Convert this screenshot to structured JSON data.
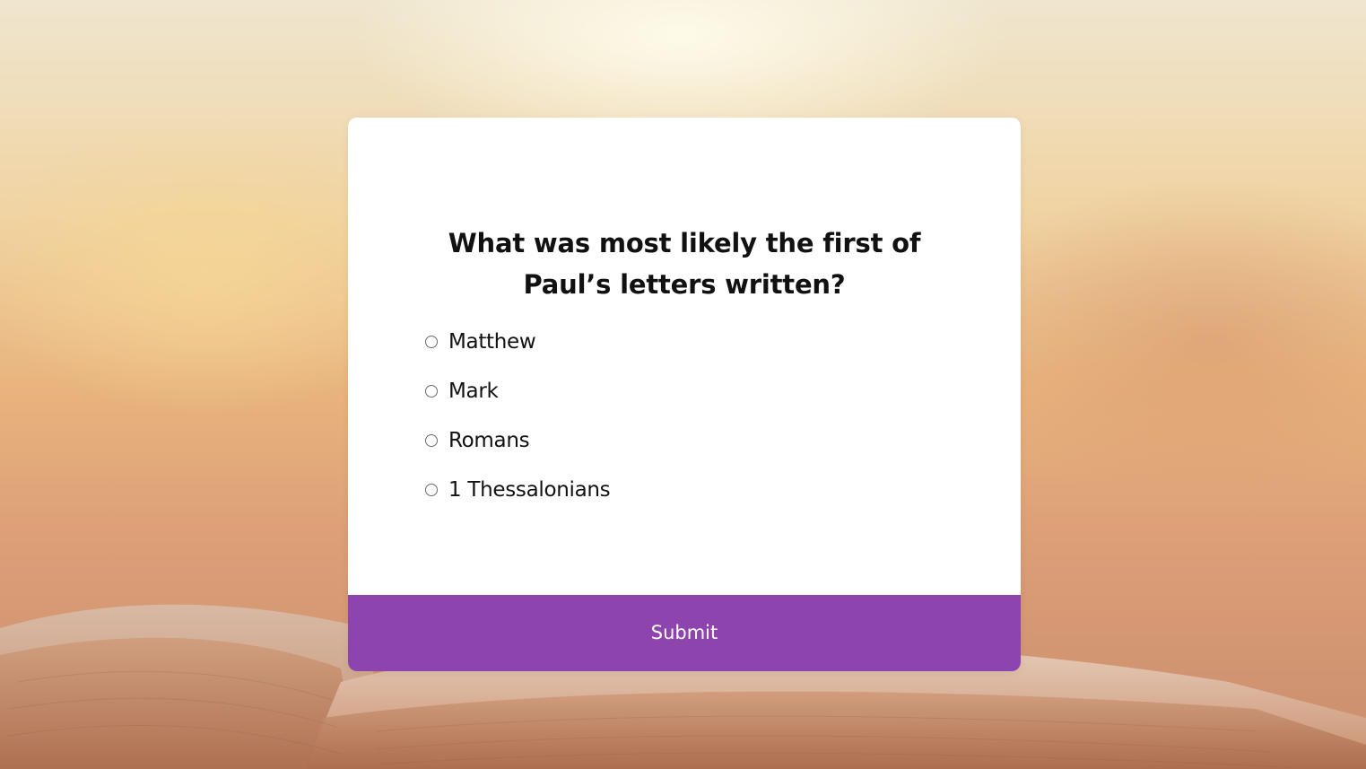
{
  "quiz": {
    "question_line1": "What was most likely the first of",
    "question_line2": "Paul’s letters written?",
    "options": [
      {
        "label": "Matthew",
        "selected": false
      },
      {
        "label": "Mark",
        "selected": false
      },
      {
        "label": "Romans",
        "selected": false
      },
      {
        "label": "1 Thessalonians",
        "selected": false
      }
    ],
    "submit_label": "Submit"
  },
  "colors": {
    "accent": "#8e44ad",
    "card": "#ffffff",
    "text": "#111111"
  },
  "background": {
    "subject": "open-book-photo"
  }
}
